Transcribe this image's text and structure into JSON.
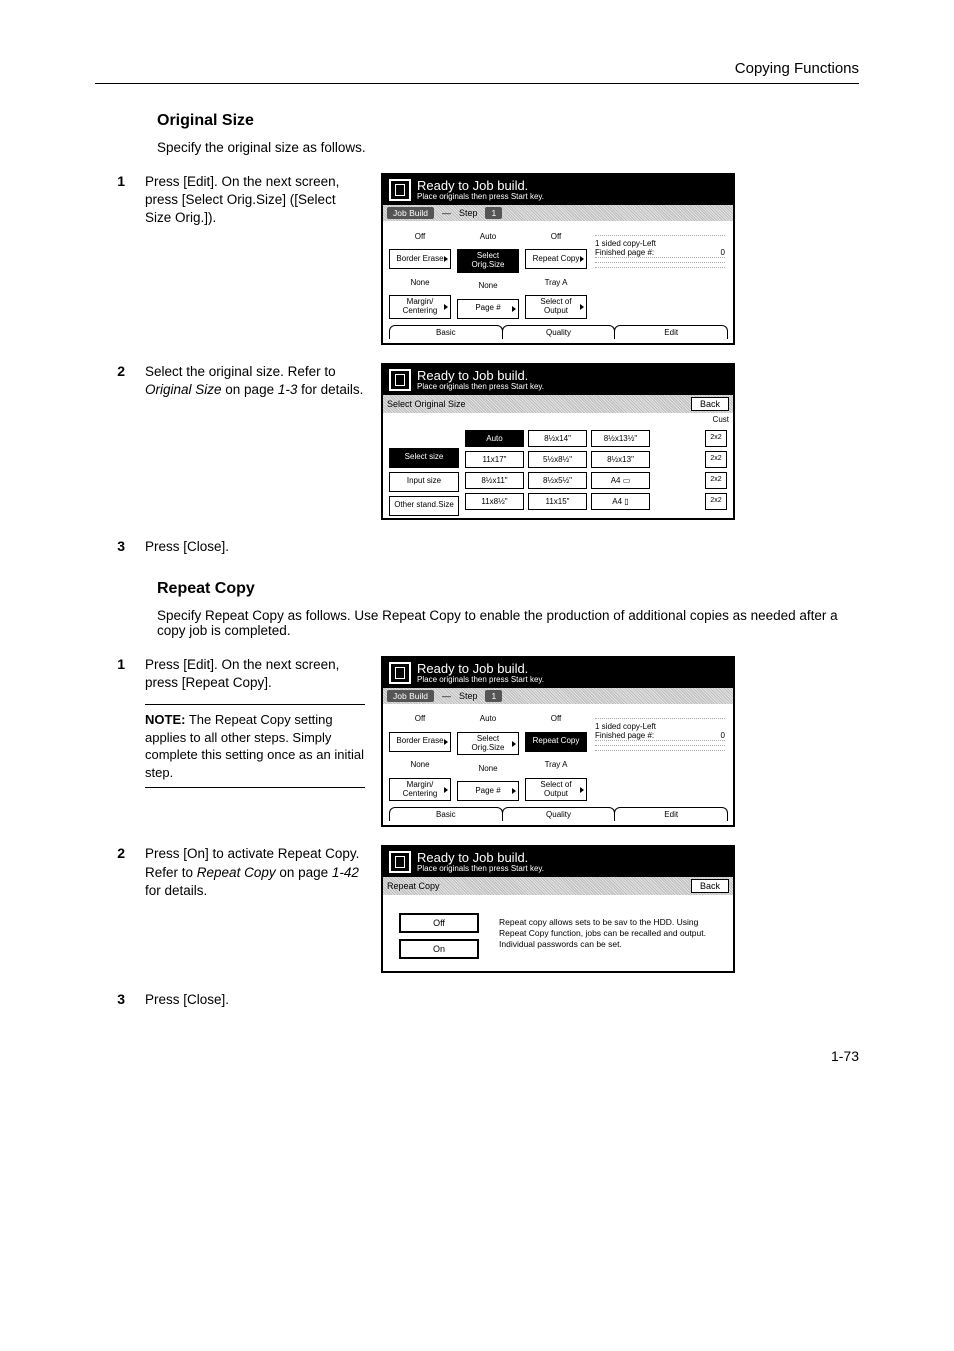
{
  "header": {
    "running": "Copying Functions"
  },
  "sec1": {
    "title": "Original Size",
    "intro": "Specify the original size as follows.",
    "step1": {
      "num": "1",
      "text_a": "Press [Edit]. On the next screen, press [Select Orig.Size] ([Select Size Orig.])."
    },
    "step2": {
      "num": "2",
      "text_a": "Select the original size. Refer to ",
      "text_i": "Original Size",
      "text_b": " on page ",
      "text_p": "1-3",
      "text_c": " for details."
    },
    "step3": {
      "num": "3",
      "text": "Press [Close]."
    }
  },
  "sec2": {
    "title": "Repeat Copy",
    "intro": "Specify Repeat Copy as follows. Use Repeat Copy to enable the production of additional copies as needed after a copy job is completed.",
    "step1": {
      "num": "1",
      "text": "Press [Edit]. On the next screen, press [Repeat Copy]."
    },
    "note": {
      "label": "NOTE:",
      "text": " The Repeat Copy setting applies to all other steps. Simply complete this setting once as an initial step."
    },
    "step2": {
      "num": "2",
      "text_a": "Press [On] to activate Repeat Copy. Refer to ",
      "text_i": "Repeat Copy",
      "text_b": " on page ",
      "text_p": "1-42",
      "text_c": " for details."
    },
    "step3": {
      "num": "3",
      "text": "Press [Close]."
    }
  },
  "panelA": {
    "title": "Ready to Job build.",
    "sub": "Place originals then press Start key.",
    "bar_left": "Job Build",
    "bar_step": "Step",
    "bar_num": "1",
    "col1": {
      "r1": "Off",
      "r2": "Border\nErase",
      "r3": "None",
      "r4": "Margin/\nCentering"
    },
    "col2": {
      "r1": "Auto",
      "r2": "Select\nOrig.Size",
      "r3": "None",
      "r4": "Page #"
    },
    "col3": {
      "r1": "Off",
      "r2": "Repeat\nCopy",
      "r3": "Tray A",
      "r4": "Select of\nOutput"
    },
    "info1": "1 sided copy-Left",
    "info2a": "Finished page #:",
    "info2b": "0",
    "tabs": {
      "t1": "Basic",
      "t2": "Quality",
      "t3": "Edit"
    }
  },
  "panelB": {
    "title": "Ready to Job build.",
    "sub": "Place originals then press Start key.",
    "bar_left": "Select Original Size",
    "back": "Back",
    "custom": "Cust",
    "left": {
      "b1": "Select\nsize",
      "b2": "Input size",
      "b3": "Other\nstand.Size"
    },
    "rows": [
      [
        "Auto",
        "8½x14\"",
        "8½x13½\"",
        "",
        "2x2"
      ],
      [
        "11x17\"",
        "5½x8½\"",
        "8½x13\"",
        "",
        "2x2"
      ],
      [
        "8½x11\"",
        "8½x5½\"",
        "A4 ▭",
        "",
        "2x2"
      ],
      [
        "11x8½\"",
        "11x15\"",
        "A4 ▯",
        "",
        "2x2"
      ]
    ]
  },
  "panelC": {
    "title": "Ready to Job build.",
    "sub": "Place originals then press Start key.",
    "bar_left": "Job Build",
    "bar_step": "Step",
    "bar_num": "1",
    "col1": {
      "r1": "Off",
      "r2": "Border\nErase",
      "r3": "None",
      "r4": "Margin/\nCentering"
    },
    "col2": {
      "r1": "Auto",
      "r2": "Select\nOrig.Size",
      "r3": "None",
      "r4": "Page #"
    },
    "col3": {
      "r1": "Off",
      "r2": "Repeat\nCopy",
      "r3": "Tray A",
      "r4": "Select of\nOutput"
    },
    "info1": "1 sided copy-Left",
    "info2a": "Finished page #:",
    "info2b": "0",
    "tabs": {
      "t1": "Basic",
      "t2": "Quality",
      "t3": "Edit"
    }
  },
  "panelD": {
    "title": "Ready to Job build.",
    "sub": "Place originals then press Start key.",
    "bar_left": "Repeat Copy",
    "back": "Back",
    "off": "Off",
    "on": "On",
    "desc": "Repeat copy allows sets to be sav to the HDD.\nUsing Repeat Copy function, jobs can be recalled and output. Individual passwords can be set."
  },
  "footer": {
    "page": "1-73"
  }
}
